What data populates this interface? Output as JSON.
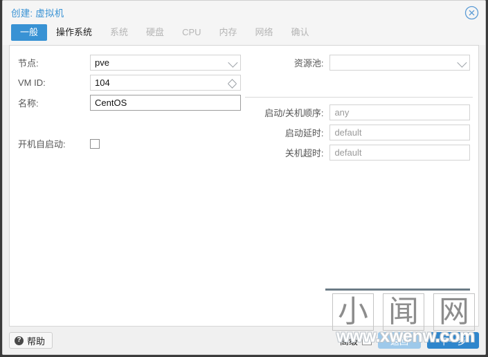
{
  "window": {
    "title": "创建: 虚拟机",
    "close_icon": "close-circle-icon"
  },
  "tabs": [
    {
      "label": "一般",
      "state": "active"
    },
    {
      "label": "操作系统",
      "state": "enabled"
    },
    {
      "label": "系统",
      "state": "disabled"
    },
    {
      "label": "硬盘",
      "state": "disabled"
    },
    {
      "label": "CPU",
      "state": "disabled"
    },
    {
      "label": "内存",
      "state": "disabled"
    },
    {
      "label": "网络",
      "state": "disabled"
    },
    {
      "label": "确认",
      "state": "disabled"
    }
  ],
  "form": {
    "left": {
      "node": {
        "label": "节点:",
        "value": "pve",
        "control": "select"
      },
      "vmid": {
        "label": "VM ID:",
        "value": "104",
        "control": "spinner"
      },
      "name": {
        "label": "名称:",
        "value": "CentOS",
        "control": "text"
      },
      "onboot": {
        "label": "开机自启动:",
        "checked": false,
        "control": "checkbox"
      }
    },
    "right": {
      "pool": {
        "label": "资源池:",
        "value": "",
        "control": "select"
      },
      "order": {
        "label": "启动/关机顺序:",
        "placeholder": "any",
        "control": "text"
      },
      "startup": {
        "label": "启动延时:",
        "placeholder": "default",
        "control": "text"
      },
      "shutdown": {
        "label": "关机超时:",
        "placeholder": "default",
        "control": "text"
      }
    }
  },
  "watermark": {
    "chars": [
      "小",
      "闻",
      "网"
    ],
    "url": "www.xwenw.com"
  },
  "footer": {
    "help_label": "帮助",
    "help_icon": "question-mark-icon",
    "advanced_label": "高级",
    "advanced_checked": false,
    "back_label": "返回",
    "next_label": "下一步"
  },
  "colors": {
    "accent": "#3892d4",
    "next_button": "#2f86cc",
    "back_button": "#9ec9ea",
    "title_text": "#3892d4"
  }
}
